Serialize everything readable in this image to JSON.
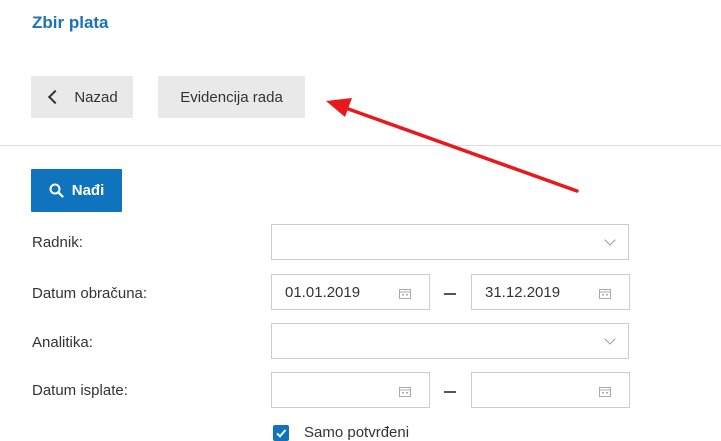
{
  "header": {
    "title": "Zbir plata"
  },
  "toolbar": {
    "back_label": "Nazad",
    "timesheet_label": "Evidencija rada"
  },
  "search": {
    "find_label": "Nađi"
  },
  "form": {
    "employee_label": "Radnik:",
    "calc_date_label": "Datum obračuna:",
    "calc_date_from": "01.01.2019",
    "calc_date_to": "31.12.2019",
    "analytics_label": "Analitika:",
    "payout_date_label": "Datum isplate:",
    "payout_date_from": "",
    "payout_date_to": "",
    "only_confirmed_label": "Samo potvrđeni",
    "only_confirmed_checked": true
  },
  "colors": {
    "brand": "#1a73b8",
    "primary_button": "#0f74bd",
    "annotation_arrow": "#e8191c"
  },
  "icons": {
    "back": "chevron-left-icon",
    "find": "search-icon",
    "dropdown": "chevron-down-icon",
    "date": "calendar-icon",
    "checkbox": "check-icon"
  }
}
